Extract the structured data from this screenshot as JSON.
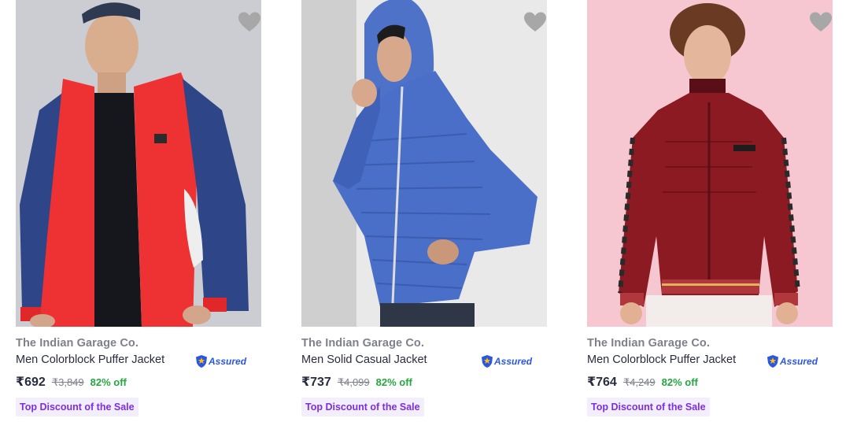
{
  "products": [
    {
      "brand": "The Indian Garage Co.",
      "title": "Men Colorblock Puffer Jacket",
      "assured": "Assured",
      "price": "₹692",
      "mrp": "₹3,849",
      "discount": "82% off",
      "tag": "Top Discount of the Sale"
    },
    {
      "brand": "The Indian Garage Co.",
      "title": "Men Solid Casual Jacket",
      "assured": "Assured",
      "price": "₹737",
      "mrp": "₹4,099",
      "discount": "82% off",
      "tag": "Top Discount of the Sale"
    },
    {
      "brand": "The Indian Garage Co.",
      "title": "Men Colorblock Puffer Jacket",
      "assured": "Assured",
      "price": "₹764",
      "mrp": "₹4,249",
      "discount": "82% off",
      "tag": "Top Discount of the Sale"
    }
  ],
  "icons": {
    "wishlist": "heart-icon",
    "assured_badge": "assured-shield-icon"
  },
  "colors": {
    "price_text": "#282c3f",
    "brand_text": "#7e818c",
    "discount_green": "#26a541",
    "assured_blue": "#2a55e5",
    "tag_purple": "#7b2fe0",
    "tag_bg": "#f3eefc",
    "wishlist_heart": "#9e9e9e"
  }
}
